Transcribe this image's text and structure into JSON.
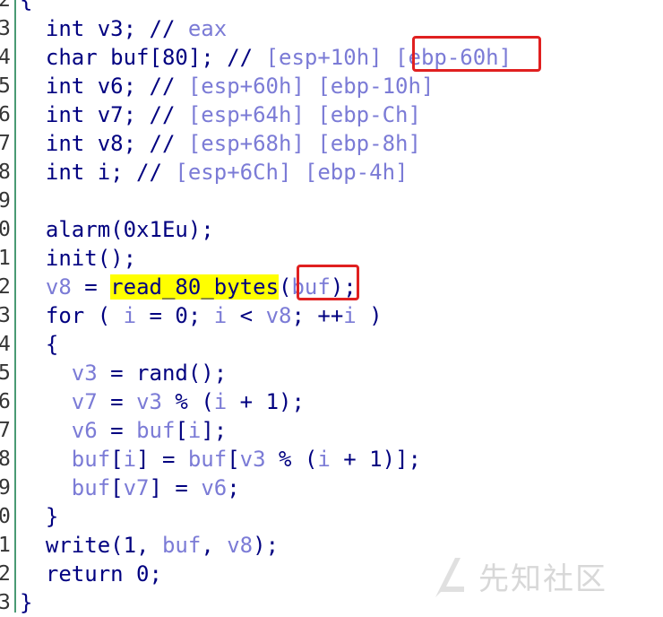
{
  "lines": [
    {
      "num": "2",
      "parts": [
        {
          "t": "{",
          "c": "pl"
        }
      ]
    },
    {
      "num": "3",
      "parts": [
        {
          "t": "  int v3; // ",
          "c": "kw"
        },
        {
          "t": "eax",
          "c": "var"
        }
      ]
    },
    {
      "num": "4",
      "parts": [
        {
          "t": "  char buf[80]; // ",
          "c": "kw"
        },
        {
          "t": "[esp+10h] [ebp-60h]",
          "c": "var"
        }
      ]
    },
    {
      "num": "5",
      "parts": [
        {
          "t": "  int v6; // ",
          "c": "kw"
        },
        {
          "t": "[esp+60h] [ebp-10h]",
          "c": "var"
        }
      ]
    },
    {
      "num": "6",
      "parts": [
        {
          "t": "  int v7; // ",
          "c": "kw"
        },
        {
          "t": "[esp+64h] [ebp-Ch]",
          "c": "var"
        }
      ]
    },
    {
      "num": "7",
      "parts": [
        {
          "t": "  int v8; // ",
          "c": "kw"
        },
        {
          "t": "[esp+68h] [ebp-8h]",
          "c": "var"
        }
      ]
    },
    {
      "num": "8",
      "parts": [
        {
          "t": "  int i; // ",
          "c": "kw"
        },
        {
          "t": "[esp+6Ch] [ebp-4h]",
          "c": "var"
        }
      ]
    },
    {
      "num": "9",
      "parts": []
    },
    {
      "num": "0",
      "parts": [
        {
          "t": "  alarm(0x1Eu);",
          "c": "fn"
        }
      ]
    },
    {
      "num": "1",
      "parts": [
        {
          "t": "  init();",
          "c": "fn"
        }
      ]
    },
    {
      "num": "2",
      "parts": [
        {
          "t": "  ",
          "c": "pl"
        },
        {
          "t": "v8",
          "c": "var"
        },
        {
          "t": " = ",
          "c": "pl"
        },
        {
          "t": "read_80_bytes",
          "c": "fn hl"
        },
        {
          "t": "(",
          "c": "pl"
        },
        {
          "t": "buf",
          "c": "var"
        },
        {
          "t": ");",
          "c": "pl"
        }
      ]
    },
    {
      "num": "3",
      "parts": [
        {
          "t": "  for ( ",
          "c": "kw"
        },
        {
          "t": "i",
          "c": "var"
        },
        {
          "t": " = 0; ",
          "c": "pl"
        },
        {
          "t": "i",
          "c": "var"
        },
        {
          "t": " < ",
          "c": "pl"
        },
        {
          "t": "v8",
          "c": "var"
        },
        {
          "t": "; ++",
          "c": "pl"
        },
        {
          "t": "i",
          "c": "var"
        },
        {
          "t": " )",
          "c": "pl"
        }
      ]
    },
    {
      "num": "4",
      "parts": [
        {
          "t": "  {",
          "c": "pl"
        }
      ]
    },
    {
      "num": "5",
      "parts": [
        {
          "t": "    ",
          "c": "pl"
        },
        {
          "t": "v3",
          "c": "var"
        },
        {
          "t": " = rand();",
          "c": "fn"
        }
      ]
    },
    {
      "num": "6",
      "parts": [
        {
          "t": "    ",
          "c": "pl"
        },
        {
          "t": "v7",
          "c": "var"
        },
        {
          "t": " = ",
          "c": "pl"
        },
        {
          "t": "v3",
          "c": "var"
        },
        {
          "t": " % (",
          "c": "pl"
        },
        {
          "t": "i",
          "c": "var"
        },
        {
          "t": " + 1);",
          "c": "pl"
        }
      ]
    },
    {
      "num": "7",
      "parts": [
        {
          "t": "    ",
          "c": "pl"
        },
        {
          "t": "v6",
          "c": "var"
        },
        {
          "t": " = ",
          "c": "pl"
        },
        {
          "t": "buf",
          "c": "var"
        },
        {
          "t": "[",
          "c": "pl"
        },
        {
          "t": "i",
          "c": "var"
        },
        {
          "t": "];",
          "c": "pl"
        }
      ]
    },
    {
      "num": "8",
      "parts": [
        {
          "t": "    ",
          "c": "pl"
        },
        {
          "t": "buf",
          "c": "var"
        },
        {
          "t": "[",
          "c": "pl"
        },
        {
          "t": "i",
          "c": "var"
        },
        {
          "t": "] = ",
          "c": "pl"
        },
        {
          "t": "buf",
          "c": "var"
        },
        {
          "t": "[",
          "c": "pl"
        },
        {
          "t": "v3",
          "c": "var"
        },
        {
          "t": " % (",
          "c": "pl"
        },
        {
          "t": "i",
          "c": "var"
        },
        {
          "t": " + 1)];",
          "c": "pl"
        }
      ]
    },
    {
      "num": "9",
      "parts": [
        {
          "t": "    ",
          "c": "pl"
        },
        {
          "t": "buf",
          "c": "var"
        },
        {
          "t": "[",
          "c": "pl"
        },
        {
          "t": "v7",
          "c": "var"
        },
        {
          "t": "] = ",
          "c": "pl"
        },
        {
          "t": "v6",
          "c": "var"
        },
        {
          "t": ";",
          "c": "pl"
        }
      ]
    },
    {
      "num": "0",
      "parts": [
        {
          "t": "  }",
          "c": "pl"
        }
      ]
    },
    {
      "num": "1",
      "parts": [
        {
          "t": "  write(1, ",
          "c": "fn"
        },
        {
          "t": "buf",
          "c": "var"
        },
        {
          "t": ", ",
          "c": "pl"
        },
        {
          "t": "v8",
          "c": "var"
        },
        {
          "t": ");",
          "c": "pl"
        }
      ]
    },
    {
      "num": "2",
      "parts": [
        {
          "t": "  return 0;",
          "c": "kw"
        }
      ]
    },
    {
      "num": "3",
      "parts": [
        {
          "t": "}",
          "c": "pl"
        }
      ]
    }
  ],
  "watermark": {
    "icon": "xianzhi-logo-icon",
    "text": "先知社区"
  },
  "colors": {
    "keyword": "#000080",
    "variable": "#7b7bd6",
    "highlight": "#ffff00",
    "annotation_box": "#e02020"
  }
}
